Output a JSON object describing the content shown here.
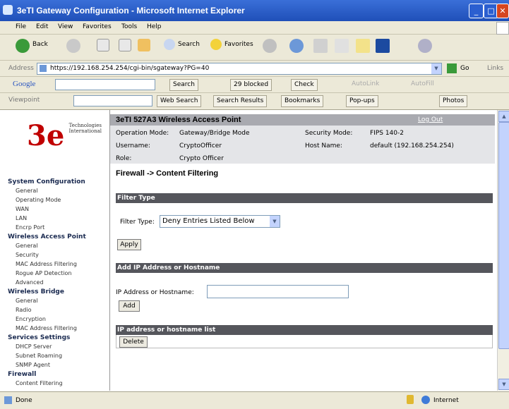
{
  "window": {
    "title": "3eTI Gateway Configuration - Microsoft Internet Explorer"
  },
  "menu": [
    "File",
    "Edit",
    "View",
    "Favorites",
    "Tools",
    "Help"
  ],
  "toolbar": {
    "back": "Back",
    "search": "Search",
    "favorites": "Favorites"
  },
  "address": {
    "label": "Address",
    "url": "https://192.168.254.254/cgi-bin/sgateway?PG=40",
    "go": "Go",
    "links": "Links"
  },
  "google_toolbar": {
    "brand": "Google",
    "search": "Search",
    "blocked": "29 blocked",
    "check": "Check",
    "autolink": "AutoLink",
    "autofill": "AutoFill"
  },
  "viewpoint_toolbar": {
    "brand": "Viewpoint",
    "web_search": "Web Search",
    "search_results": "Search Results",
    "bookmarks": "Bookmarks",
    "popups": "Pop-ups",
    "photos": "Photos"
  },
  "logo": {
    "mark": "3e",
    "company": "Technologies International"
  },
  "sidebar": {
    "sections": [
      {
        "title": "System Configuration",
        "items": [
          "General",
          "Operating Mode",
          "WAN",
          "LAN",
          "Encrp Port"
        ]
      },
      {
        "title": "Wireless Access Point",
        "items": [
          "General",
          "Security",
          "MAC Address Filtering",
          "Rogue AP Detection",
          "Advanced"
        ]
      },
      {
        "title": "Wireless Bridge",
        "items": [
          "General",
          "Radio",
          "Encryption",
          "MAC Address Filtering"
        ]
      },
      {
        "title": "Services Settings",
        "items": [
          "DHCP Server",
          "Subnet Roaming",
          "SNMP Agent"
        ]
      },
      {
        "title": "Firewall",
        "items": [
          "Content Filtering"
        ]
      }
    ]
  },
  "header": {
    "product": "3eTI 527A3 Wireless Access Point",
    "logout": "Log Out",
    "operation_mode_label": "Operation Mode:",
    "operation_mode_value": "Gateway/Bridge Mode",
    "username_label": "Username:",
    "username_value": "CryptoOfficer",
    "role_label": "Role:",
    "role_value": "Crypto Officer",
    "security_mode_label": "Security Mode:",
    "security_mode_value": "FIPS 140-2",
    "host_name_label": "Host Name:",
    "host_name_value": "default (192.168.254.254)"
  },
  "page": {
    "title": "Firewall -> Content Filtering",
    "filter_type_section": "Filter Type",
    "filter_type_label": "Filter Type:",
    "filter_type_value": "Deny Entries Listed Below",
    "apply": "Apply",
    "add_section": "Add IP Address or Hostname",
    "ip_label": "IP Address or Hostname:",
    "add": "Add",
    "list_section": "IP address or hostname list",
    "delete": "Delete"
  },
  "status": {
    "left": "Done",
    "zone": "Internet"
  }
}
